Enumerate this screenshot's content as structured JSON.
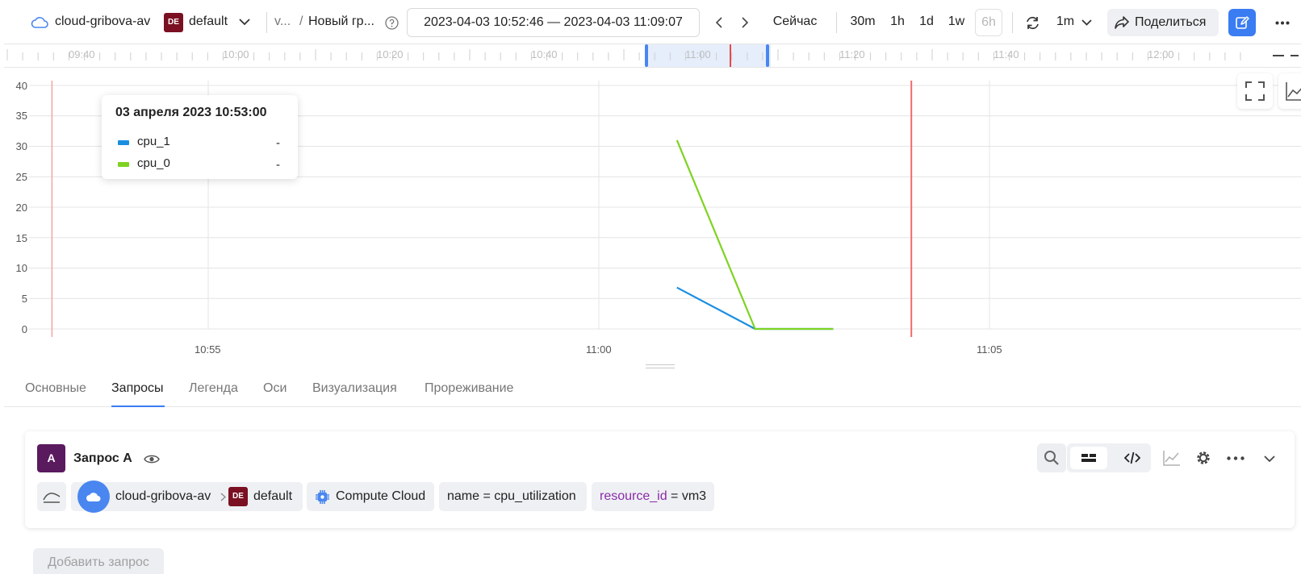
{
  "header": {
    "folder": "cloud-gribova-av",
    "workspace_badge": "DE",
    "workspace": "default",
    "breadcrumb_short": "v...",
    "breadcrumb_sep": "/",
    "dashboard_title": "Новый гр...",
    "date_range": "2023-04-03 10:52:46 — 2023-04-03 11:09:07",
    "now_label": "Сейчас",
    "presets": [
      "30m",
      "1h",
      "1d",
      "1w",
      "6h"
    ],
    "refresh_interval": "1m",
    "share_label": "Поделиться"
  },
  "timeline": {
    "labels": [
      "09:40",
      "10:00",
      "10:20",
      "10:40",
      "11:00",
      "11:20",
      "11:40",
      "12:00"
    ]
  },
  "chart_data": {
    "type": "line",
    "yticks": [
      "40",
      "35",
      "30",
      "25",
      "20",
      "15",
      "10",
      "5",
      "0"
    ],
    "xticks": [
      "10:55",
      "11:00",
      "11:05"
    ],
    "ylim": [
      0,
      40
    ],
    "x_time_range": [
      "10:53:00",
      "11:06:40"
    ],
    "series": [
      {
        "name": "cpu_1",
        "color": "#1a8fe0",
        "x": [
          "11:01:00",
          "11:02:00",
          "11:03:00"
        ],
        "y": [
          6.8,
          0,
          0
        ]
      },
      {
        "name": "cpu_0",
        "color": "#7ed321",
        "x": [
          "11:01:00",
          "11:02:00",
          "11:03:00"
        ],
        "y": [
          31,
          0,
          0
        ]
      }
    ],
    "markers": [
      "10:53:00",
      "11:04:00"
    ]
  },
  "tooltip": {
    "title": "03 апреля 2023 10:53:00",
    "rows": [
      {
        "name": "cpu_1",
        "value": "-",
        "color": "#1a8fe0"
      },
      {
        "name": "cpu_0",
        "value": "-",
        "color": "#7ed321"
      }
    ]
  },
  "tabs": [
    "Основные",
    "Запросы",
    "Легенда",
    "Оси",
    "Визуализация",
    "Прореживание"
  ],
  "query": {
    "letter": "A",
    "title": "Запрос A",
    "folder": "cloud-gribova-av",
    "workspace_badge": "DE",
    "workspace": "default",
    "service": "Compute Cloud",
    "filter1": "name = cpu_utilization",
    "filter2_key": "resource_id",
    "filter2_rest": " = vm3"
  },
  "add_query_label": "Добавить запрос"
}
